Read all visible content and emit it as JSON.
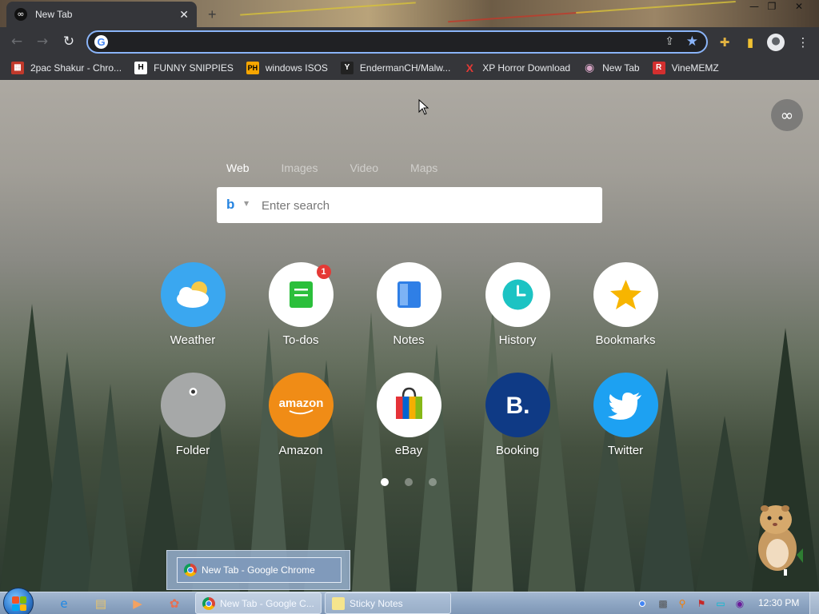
{
  "browser": {
    "tab_title": "New Tab",
    "tab_favicon": "∞",
    "tab_close": "✕",
    "new_tab": "+",
    "window_controls": {
      "minimize": "—",
      "restore": "❐",
      "close": "✕"
    },
    "omnibox_value": "",
    "omnibox_icon": "G"
  },
  "bookmarks": [
    {
      "label": "2pac Shakur - Chro...",
      "icon": "▦",
      "icon_bg": "#c0392b",
      "icon_fg": "#ffffff"
    },
    {
      "label": "FUNNY SNIPPIES",
      "icon": "H",
      "icon_bg": "#ffffff",
      "icon_fg": "#000000"
    },
    {
      "label": "windows ISOS",
      "icon": "PH",
      "icon_bg": "#f7a600",
      "icon_fg": "#000000"
    },
    {
      "label": "EndermanCH/Malw...",
      "icon": "Y",
      "icon_bg": "#222222",
      "icon_fg": "#ffffff"
    },
    {
      "label": "XP Horror Download",
      "icon": "X",
      "icon_bg": "transparent",
      "icon_fg": "#e53935"
    },
    {
      "label": "New Tab",
      "icon": "◉",
      "icon_bg": "transparent",
      "icon_fg": "#d6a4c4"
    },
    {
      "label": "VineMEMZ",
      "icon": "R",
      "icon_bg": "#d32f2f",
      "icon_fg": "#ffffff"
    }
  ],
  "newtab": {
    "infinity_button": "∞",
    "search_tabs": [
      "Web",
      "Images",
      "Video",
      "Maps"
    ],
    "active_search_tab": 0,
    "search_engine_icon": "b",
    "search_placeholder": "Enter search",
    "shortcuts_row1": [
      {
        "label": "Weather",
        "icon": "weather-icon",
        "bg": "#3aa7f0"
      },
      {
        "label": "To-dos",
        "icon": "todos-icon",
        "bg": "#ffffff",
        "badge": "1"
      },
      {
        "label": "Notes",
        "icon": "notes-icon",
        "bg": "#ffffff"
      },
      {
        "label": "History",
        "icon": "history-icon",
        "bg": "#ffffff"
      },
      {
        "label": "Bookmarks",
        "icon": "bookmarks-star-icon",
        "bg": "#ffffff"
      }
    ],
    "shortcuts_row2": [
      {
        "label": "Folder",
        "icon": "folder-icon",
        "bg": "#a6a8a8"
      },
      {
        "label": "Amazon",
        "icon": "amazon-logo-icon",
        "bg": "#f08c16",
        "text": "amazon"
      },
      {
        "label": "eBay",
        "icon": "ebay-bag-icon",
        "bg": "#ffffff"
      },
      {
        "label": "Booking",
        "icon": "booking-logo-icon",
        "bg": "#0f3a85",
        "text": "B."
      },
      {
        "label": "Twitter",
        "icon": "twitter-bird-icon",
        "bg": "#1da1f2"
      }
    ],
    "page_dots": 3,
    "active_page": 0
  },
  "taskbar_preview": {
    "label": "New Tab - Google Chrome"
  },
  "taskbar": {
    "buttons": [
      {
        "label": "New Tab - Google C...",
        "icon": "chrome-icon"
      },
      {
        "label": "Sticky Notes",
        "icon": "sticky-notes-icon"
      }
    ],
    "clock": "12:30 PM"
  }
}
